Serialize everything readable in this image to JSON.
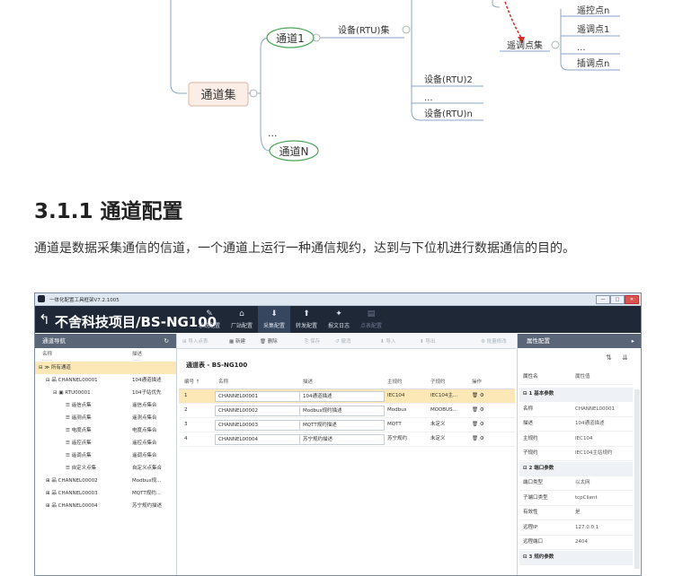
{
  "mindmap": {
    "channel1": "通道1",
    "device_set": "设备(RTU)集",
    "remote_control": "遥控点n",
    "teleadjust1": "遥调点1",
    "teleadjust_set": "遥调点集",
    "ellipsis": "...",
    "interp_n": "插调点n",
    "channel_set": "通道集",
    "device2": "设备(RTU)2",
    "device_n": "设备(RTU)n",
    "channel_n": "通道N"
  },
  "section": {
    "heading": "3.1.1 通道配置",
    "paragraph": "通道是数据采集通信的信道，一个通道上运行一种通信规约，达到与下位机进行数据通信的目的。"
  },
  "app": {
    "title": "一体化配置工具框架V7.2.1005",
    "project": "不舍科技项目/BS-NG100",
    "win_buttons": [
      "—",
      "□",
      "✕"
    ],
    "nav": [
      {
        "icon": "✎",
        "label": "系统配置"
      },
      {
        "icon": "⌂",
        "label": "厂站配置"
      },
      {
        "icon": "⬇",
        "label": "采集配置"
      },
      {
        "icon": "⬆",
        "label": "转发配置"
      },
      {
        "icon": "✦",
        "label": "报文日志"
      },
      {
        "icon": "▤",
        "label": "点表配置"
      }
    ],
    "left": {
      "title": "通道导航",
      "refresh": "↻",
      "col_name": "名称",
      "col_desc": "描述",
      "tree": [
        {
          "name": "⊟ ≫ 所有通道",
          "desc": ""
        },
        {
          "name": "⊟ 品 CHANNEL00001",
          "desc": "104通道描述"
        },
        {
          "name": "⊟ ▣ RTU00001",
          "desc": "104子站优先"
        },
        {
          "name": "☰ 遥信点集",
          "desc": "遥信点集合"
        },
        {
          "name": "☰ 遥测点集",
          "desc": "遥测点集合"
        },
        {
          "name": "☰ 电度点集",
          "desc": "电度点集合"
        },
        {
          "name": "☰ 遥控点集",
          "desc": "遥控点集合"
        },
        {
          "name": "☰ 遥调点集",
          "desc": "遥调点集合"
        },
        {
          "name": "☰ 自定义点集",
          "desc": "自定义点集合"
        },
        {
          "name": "⊞ 品 CHANNEL00002",
          "desc": "Modbus规..."
        },
        {
          "name": "⊞ 品 CHANNEL00003",
          "desc": "MQTT规约..."
        },
        {
          "name": "⊞ 品 CHANNEL00004",
          "desc": "苏宁规约描述"
        }
      ]
    },
    "toolbar": [
      {
        "label": "⊞ 导入点表",
        "dim": true
      },
      {
        "label": "▦ 新建",
        "dim": false
      },
      {
        "label": "🗑 删除",
        "dim": false
      },
      {
        "label": "⎘ 保存",
        "dim": true
      },
      {
        "label": "↺ 撤消",
        "dim": true
      },
      {
        "label": "⬇ 导入",
        "dim": true
      },
      {
        "label": "⬆ 导出",
        "dim": true
      },
      {
        "label": "⚙ 批量修改",
        "dim": true
      }
    ],
    "center": {
      "title": "通道表 - BS-NG100",
      "headers": [
        "编号 ↑",
        "名称",
        "描述",
        "主规约",
        "子规约",
        "操作"
      ],
      "rows": [
        {
          "no": "1",
          "name": "CHANNEL00001",
          "desc": "104通道描述",
          "main": "IEC104",
          "sub": "IEC104主...",
          "ops": "🗑 ⚙"
        },
        {
          "no": "2",
          "name": "CHANNEL00002",
          "desc": "Modbus规约描述",
          "main": "Modbus",
          "sub": "MODBUS...",
          "ops": "🗑 ⚙"
        },
        {
          "no": "3",
          "name": "CHANNEL00003",
          "desc": "MQTT规约描述",
          "main": "MQTT",
          "sub": "未定义",
          "ops": "🗑 ⚙"
        },
        {
          "no": "4",
          "name": "CHANNEL00004",
          "desc": "苏宁规约描述",
          "main": "苏宁规约",
          "sub": "未定义",
          "ops": "🗑 ⚙"
        }
      ]
    },
    "right": {
      "title": "属性配置",
      "arrow": "▸",
      "sort_buttons": [
        "⇅",
        "⇊"
      ],
      "col_name": "属性名",
      "col_value": "属性值",
      "rows": [
        {
          "name": "⊟ 1 基本参数",
          "value": "",
          "group": true
        },
        {
          "name": "名称",
          "value": "CHANNEL00001",
          "group": false
        },
        {
          "name": "描述",
          "value": "104通道描述",
          "group": false
        },
        {
          "name": "主规约",
          "value": "IEC104",
          "group": false
        },
        {
          "name": "子规约",
          "value": "IEC104主站规约",
          "group": false
        },
        {
          "name": "⊟ 2 端口参数",
          "value": "",
          "group": true
        },
        {
          "name": "端口类型",
          "value": "以太网",
          "group": false
        },
        {
          "name": "子端口类型",
          "value": "tcpClient",
          "group": false
        },
        {
          "name": "有效性",
          "value": "是",
          "group": false
        },
        {
          "name": "远程IP",
          "value": "127.0.0.1",
          "group": false
        },
        {
          "name": "远程端口",
          "value": "2404",
          "group": false
        },
        {
          "name": "⊟ 3 规约参数",
          "value": "",
          "group": true
        }
      ]
    }
  }
}
